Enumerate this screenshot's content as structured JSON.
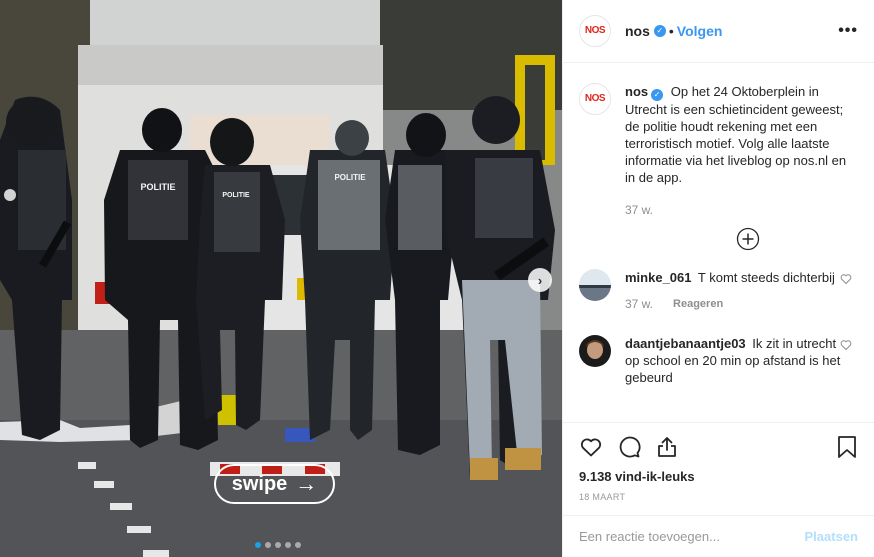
{
  "photo": {
    "swipe_label": "swipe",
    "swipe_arrow": "→",
    "next_arrow": "›",
    "carousel_dots": 5,
    "active_dot": 1,
    "vest_text": "POLITIE"
  },
  "header": {
    "avatar_logo": "NOS",
    "username": "nos",
    "separator": "•",
    "follow_label": "Volgen",
    "more_label": "•••"
  },
  "caption": {
    "username": "nos",
    "text": "Op het 24 Oktoberplein in Utrecht is een schietincident geweest; de politie houdt rekening met een terroristisch motief. Volg alle laatste informatie via het liveblog op nos.nl en in de app.",
    "time": "37 w."
  },
  "comments": [
    {
      "username": "minke_061",
      "text": "T komt steeds dichterbij",
      "time": "37 w.",
      "reply_label": "Reageren"
    },
    {
      "username": "daantjebanaantje03",
      "text": "Ik zit in utrecht op school en 20 min op afstand is het gebeurd"
    }
  ],
  "post": {
    "likes": "9.138 vind-ik-leuks",
    "date": "18 MAART"
  },
  "compose": {
    "placeholder": "Een reactie toevoegen...",
    "post_label": "Plaatsen"
  },
  "colors": {
    "accent": "#3897f0",
    "brand_red": "#e1261c",
    "text": "#262626",
    "muted": "#8e8e8e",
    "post_disabled": "#b2dffc"
  }
}
